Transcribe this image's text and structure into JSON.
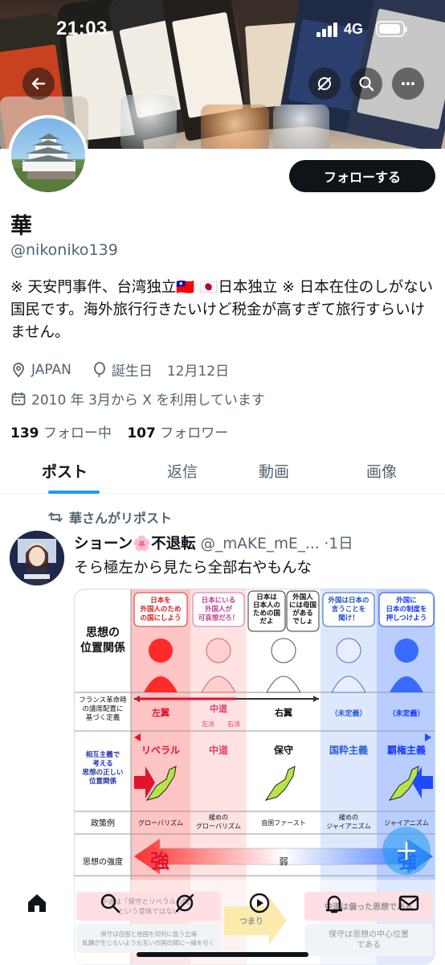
{
  "status_bar": {
    "time": "21:03",
    "network": "4G"
  },
  "profile": {
    "display_name": "華",
    "handle": "@nikoniko139",
    "follow_label": "フォローする",
    "bio": "※ 天安門事件、台湾独立🇹🇼 🇯🇵日本独立 ※ 日本在住のしがない国民です。海外旅行行きたいけど税金が高すぎて旅行すらいけません。",
    "location": "JAPAN",
    "birthday_label": "誕生日",
    "birthday": "12月12日",
    "joined": "2010 年 3月から X を利用しています",
    "following_count": "139",
    "following_label": "フォロー中",
    "followers_count": "107",
    "followers_label": "フォロワー"
  },
  "tabs": [
    "ポスト",
    "返信",
    "動画",
    "画像"
  ],
  "post": {
    "repost_label": "華さんがリポスト",
    "author_name": "ショーン🌸不退転",
    "author_handle": "@_mAKE_mE_...",
    "time": "·1日",
    "text": "そら極左から見たら全部右やもんな"
  },
  "infographic": {
    "row_labels": {
      "position": "思想の\n位置関係",
      "french": "フランス革命時\nの議席配置に\n基づく定義",
      "mutual": "相互主義で\n考える\n思想の正しい\n位置関係",
      "policy": "政策例",
      "strength": "思想の強度"
    },
    "speech": [
      "日本を\n外国人のため\nの国にしよう",
      "日本にいる\n外国人が\n可哀想だろ！",
      "日本は\n日本人の\nための国\nだよ",
      "外国人\nには母国\nがある\nでしょ",
      "外国は日本の\n言うことを\n聞け！",
      "外国に\n日本の制度を\n押しつけよう"
    ],
    "french_labels": [
      "左翼",
      "中道",
      "右翼",
      "（未定義）",
      "（未定義）"
    ],
    "french_sub": [
      "左派",
      "右派"
    ],
    "mutual_labels": [
      "リベラル",
      "中道",
      "保守",
      "国粋主義",
      "覇権主義"
    ],
    "policy_labels": [
      "グローバリズム",
      "緩めの\nグローバリズム",
      "自国ファースト",
      "緩めの\nジャイアニズム",
      "ジャイアニズム"
    ],
    "strength_strong": "強",
    "strength_weak": "弱",
    "footer_left_1": "中道は「保守とリベラルの間」\nという意味ではない",
    "footer_left_2": "保守は自国と他国を同列に扱う立場\n軋轢が生じないようお互いの国の間に一線を引く",
    "footer_mid": "つまり",
    "footer_right_1": "中道は偏った思想である",
    "footer_right_2": "保守は思想の中心位置\nである"
  },
  "colors": {
    "accent": "#1d9bf0",
    "text": "#0f1419",
    "muted": "#536471"
  }
}
